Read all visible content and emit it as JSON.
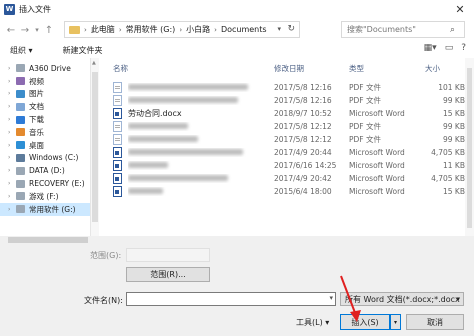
{
  "window": {
    "title": "插入文件",
    "app_icon": "W",
    "close_glyph": "✕"
  },
  "address": {
    "crumbs": [
      "此电脑",
      "常用软件 (G:)",
      "小白路",
      "Documents"
    ],
    "search_placeholder": "搜索\"Documents\""
  },
  "toolbar": {
    "organize": "组织 ▾",
    "new_folder": "新建文件夹"
  },
  "nav": {
    "items": [
      {
        "label": "A360 Drive",
        "icon": "drive"
      },
      {
        "label": "视频",
        "icon": "video"
      },
      {
        "label": "图片",
        "icon": "pic"
      },
      {
        "label": "文档",
        "icon": "doc"
      },
      {
        "label": "下载",
        "icon": "down"
      },
      {
        "label": "音乐",
        "icon": "music"
      },
      {
        "label": "桌面",
        "icon": "desk"
      },
      {
        "label": "Windows (C:)",
        "icon": "win"
      },
      {
        "label": "DATA (D:)",
        "icon": "drive"
      },
      {
        "label": "RECOVERY (E:)",
        "icon": "drive"
      },
      {
        "label": "游戏 (F:)",
        "icon": "drive"
      },
      {
        "label": "常用软件 (G:)",
        "icon": "drive"
      }
    ]
  },
  "columns": {
    "name": "名称",
    "date": "修改日期",
    "type": "类型",
    "size": "大小"
  },
  "files": [
    {
      "name": "",
      "date": "2017/5/8 12:16",
      "type": "PDF 文件",
      "size": "101 KB",
      "icon": "pdf"
    },
    {
      "name": "",
      "date": "2017/5/8 12:16",
      "type": "PDF 文件",
      "size": "99 KB",
      "icon": "pdf"
    },
    {
      "name": "劳动合同.docx",
      "date": "2018/9/7 10:52",
      "type": "Microsoft Word",
      "size": "15 KB",
      "icon": "word"
    },
    {
      "name": "",
      "date": "2017/5/8 12:12",
      "type": "PDF 文件",
      "size": "99 KB",
      "icon": "pdf"
    },
    {
      "name": "",
      "date": "2017/5/8 12:12",
      "type": "PDF 文件",
      "size": "99 KB",
      "icon": "pdf"
    },
    {
      "name": "",
      "date": "2017/4/9 20:44",
      "type": "Microsoft Word",
      "size": "4,705 KB",
      "icon": "word"
    },
    {
      "name": "",
      "date": "2017/6/16 14:25",
      "type": "Microsoft Word",
      "size": "11 KB",
      "icon": "word"
    },
    {
      "name": "",
      "date": "2017/4/9 20:42",
      "type": "Microsoft Word",
      "size": "4,705 KB",
      "icon": "word"
    },
    {
      "name": "",
      "date": "2015/6/4 18:00",
      "type": "Microsoft Word",
      "size": "15 KB",
      "icon": "word"
    }
  ],
  "bottom": {
    "range_label": "范围(G):",
    "range_button": "范围(R)...",
    "filename_label": "文件名(N):",
    "filename_value": "",
    "filter": "所有 Word 文档(*.docx;*.docx",
    "tools": "工具(L) ▾",
    "insert": "插入(S)",
    "cancel": "取消"
  },
  "colors": {
    "accent": "#0078d7",
    "selection": "#cce8ff",
    "annotation": "#e02020"
  }
}
